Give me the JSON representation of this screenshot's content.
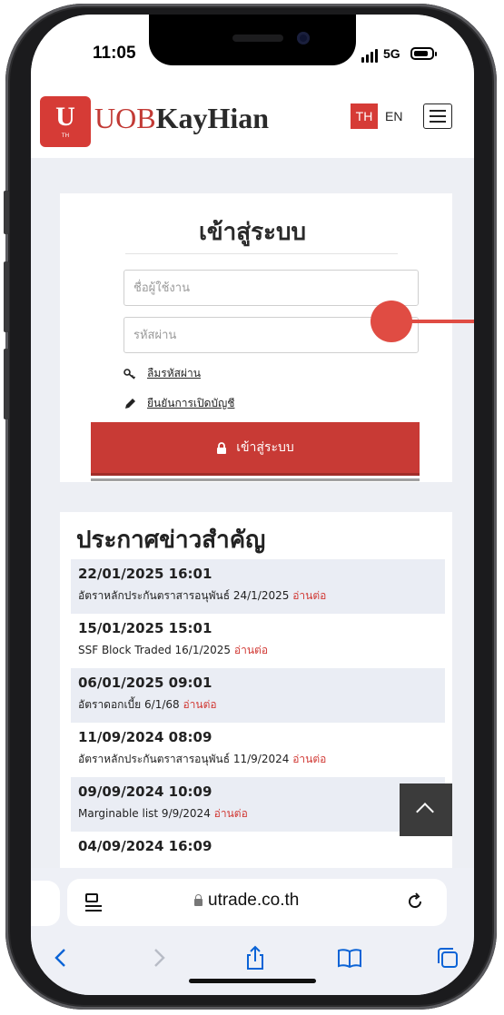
{
  "status_bar": {
    "time": "11:05",
    "network": "5G",
    "battery_level": 0.85
  },
  "header": {
    "logo_letter": "U",
    "logo_sub": "TH",
    "brand_prefix": "UOB",
    "brand_suffix": "KayHian",
    "lang_th": "TH",
    "lang_en": "EN",
    "menu_icon": "hamburger-icon"
  },
  "login": {
    "title": "เข้าสู่ระบบ",
    "username_placeholder": "ชื่อผู้ใช้งาน",
    "password_placeholder": "รหัสผ่าน",
    "forgot_password": "ลืมรหัสผ่าน",
    "confirm_account": "ยืนยันการเปิดบัญชี",
    "submit_label": "เข้าสู่ระบบ"
  },
  "news": {
    "title": "ประกาศข่าวสำคัญ",
    "read_more": "อ่านต่อ",
    "items": [
      {
        "date": "22/01/2025 16:01",
        "text": "อัตราหลักประกันตราสารอนุพันธ์ 24/1/2025"
      },
      {
        "date": "15/01/2025 15:01",
        "text": "SSF Block Traded 16/1/2025"
      },
      {
        "date": "06/01/2025 09:01",
        "text": "อัตราดอกเบี้ย 6/1/68"
      },
      {
        "date": "11/09/2024 08:09",
        "text": "อัตราหลักประกันตราสารอนุพันธ์ 11/9/2024"
      },
      {
        "date": "09/09/2024 10:09",
        "text": "Marginable list 9/9/2024"
      },
      {
        "date": "04/09/2024 16:09",
        "text": ""
      }
    ]
  },
  "safari": {
    "url": "utrade.co.th",
    "icons": [
      "back-icon",
      "forward-icon",
      "share-icon",
      "bookmarks-icon",
      "tabs-icon"
    ]
  },
  "colors": {
    "brand_red": "#c83a35",
    "accent_red": "#d13a35",
    "annotation": "#e04c43"
  }
}
